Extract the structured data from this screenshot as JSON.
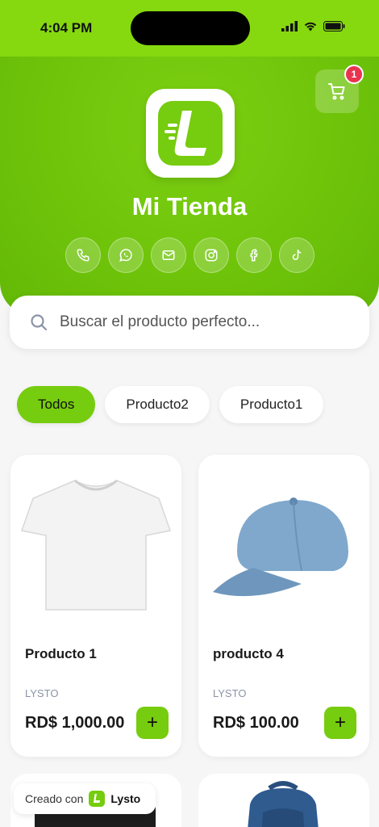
{
  "status_bar": {
    "time": "4:04 PM"
  },
  "header": {
    "store_name": "Mi Tienda",
    "cart_count": "1",
    "social_icons": [
      "phone-icon",
      "whatsapp-icon",
      "mail-icon",
      "instagram-icon",
      "facebook-icon",
      "tiktok-icon"
    ]
  },
  "search": {
    "placeholder": "Buscar el producto perfecto..."
  },
  "filters": [
    "Todos",
    "Producto2",
    "Producto1"
  ],
  "products": [
    {
      "name": "Producto 1",
      "brand": "LYSTO",
      "price": "RD$ 1,000.00",
      "image": "white-tshirt"
    },
    {
      "name": "producto 4",
      "brand": "LYSTO",
      "price": "RD$ 100.00",
      "image": "blue-cap"
    }
  ],
  "footer": {
    "created_by": "Creado con",
    "brand": "Lysto"
  },
  "colors": {
    "accent": "#76cc0e",
    "badge": "#e8344f"
  }
}
